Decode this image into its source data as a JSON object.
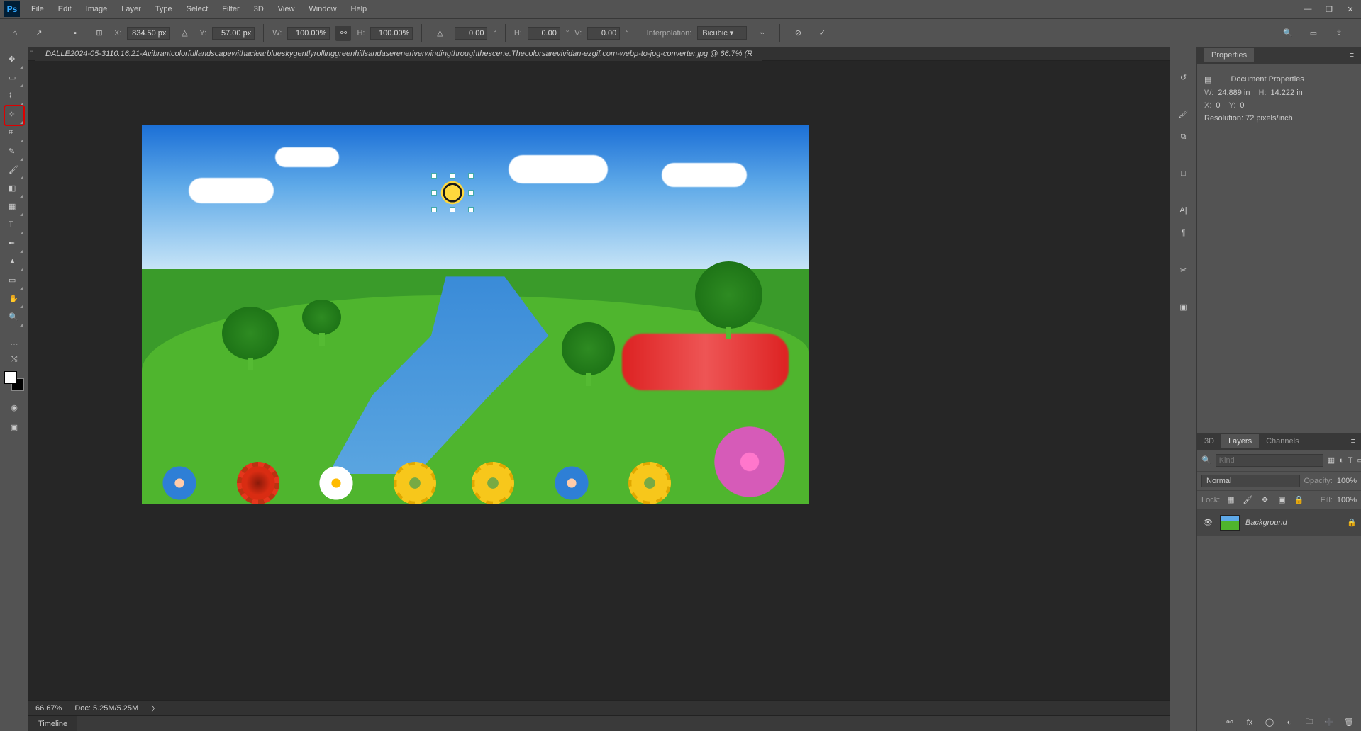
{
  "menu": {
    "items": [
      "File",
      "Edit",
      "Image",
      "Layer",
      "Type",
      "Select",
      "Filter",
      "3D",
      "View",
      "Window",
      "Help"
    ]
  },
  "optbar": {
    "x_label": "X:",
    "x_val": "834.50 px",
    "y_label": "Y:",
    "y_val": "57.00 px",
    "w_label": "W:",
    "w_val": "100.00%",
    "h_label": "H:",
    "h_val": "100.00%",
    "rot_val": "0.00",
    "rot_unit": "°",
    "skh_label": "H:",
    "skh_val": "0.00",
    "skh_unit": "°",
    "skv_label": "V:",
    "skv_val": "0.00",
    "skv_unit": "°",
    "interp_label": "Interpolation:",
    "interp_val": "Bicubic"
  },
  "doc": {
    "tab_title": "DALLE2024-05-3110.16.21-Avibrantcolorfullandscapewithaclearblueskygentlyrollinggreenhillsandasereneriverwindingthroughthescene.Thecolorsarevividan-ezgif.com-webp-to-jpg-converter.jpg @ 66.7% (R"
  },
  "status": {
    "zoom": "66.67%",
    "doc": "Doc: 5.25M/5.25M"
  },
  "timeline": {
    "label": "Timeline"
  },
  "tools": [
    {
      "name": "move-tool",
      "glyph": "✥"
    },
    {
      "name": "marquee-tool",
      "glyph": "▭"
    },
    {
      "name": "lasso-tool",
      "glyph": "⌇"
    },
    {
      "name": "magic-wand-tool",
      "glyph": "✧",
      "active": true
    },
    {
      "name": "crop-tool",
      "glyph": "⌗"
    },
    {
      "name": "eyedropper-tool",
      "glyph": "✎"
    },
    {
      "name": "brush-tool",
      "glyph": "🖌"
    },
    {
      "name": "eraser-tool",
      "glyph": "◧"
    },
    {
      "name": "gradient-tool",
      "glyph": "▦"
    },
    {
      "name": "type-tool",
      "glyph": "T"
    },
    {
      "name": "pen-tool",
      "glyph": "✒"
    },
    {
      "name": "path-select-tool",
      "glyph": "▲"
    },
    {
      "name": "shape-tool",
      "glyph": "▭"
    },
    {
      "name": "hand-tool",
      "glyph": "✋"
    },
    {
      "name": "zoom-tool",
      "glyph": "🔍"
    }
  ],
  "properties": {
    "panel_title": "Properties",
    "section": "Document Properties",
    "w_label": "W:",
    "w_val": "24.889 in",
    "h_label": "H:",
    "h_val": "14.222 in",
    "x_label": "X:",
    "x_val": "0",
    "y_label": "Y:",
    "y_val": "0",
    "res": "Resolution: 72 pixels/inch"
  },
  "layers": {
    "tabs": [
      "3D",
      "Layers",
      "Channels"
    ],
    "active_tab": 1,
    "kind_placeholder": "Kind",
    "blend": "Normal",
    "opacity_label": "Opacity:",
    "opacity_val": "100%",
    "lock_label": "Lock:",
    "fill_label": "Fill:",
    "fill_val": "100%",
    "layer_name": "Background"
  }
}
